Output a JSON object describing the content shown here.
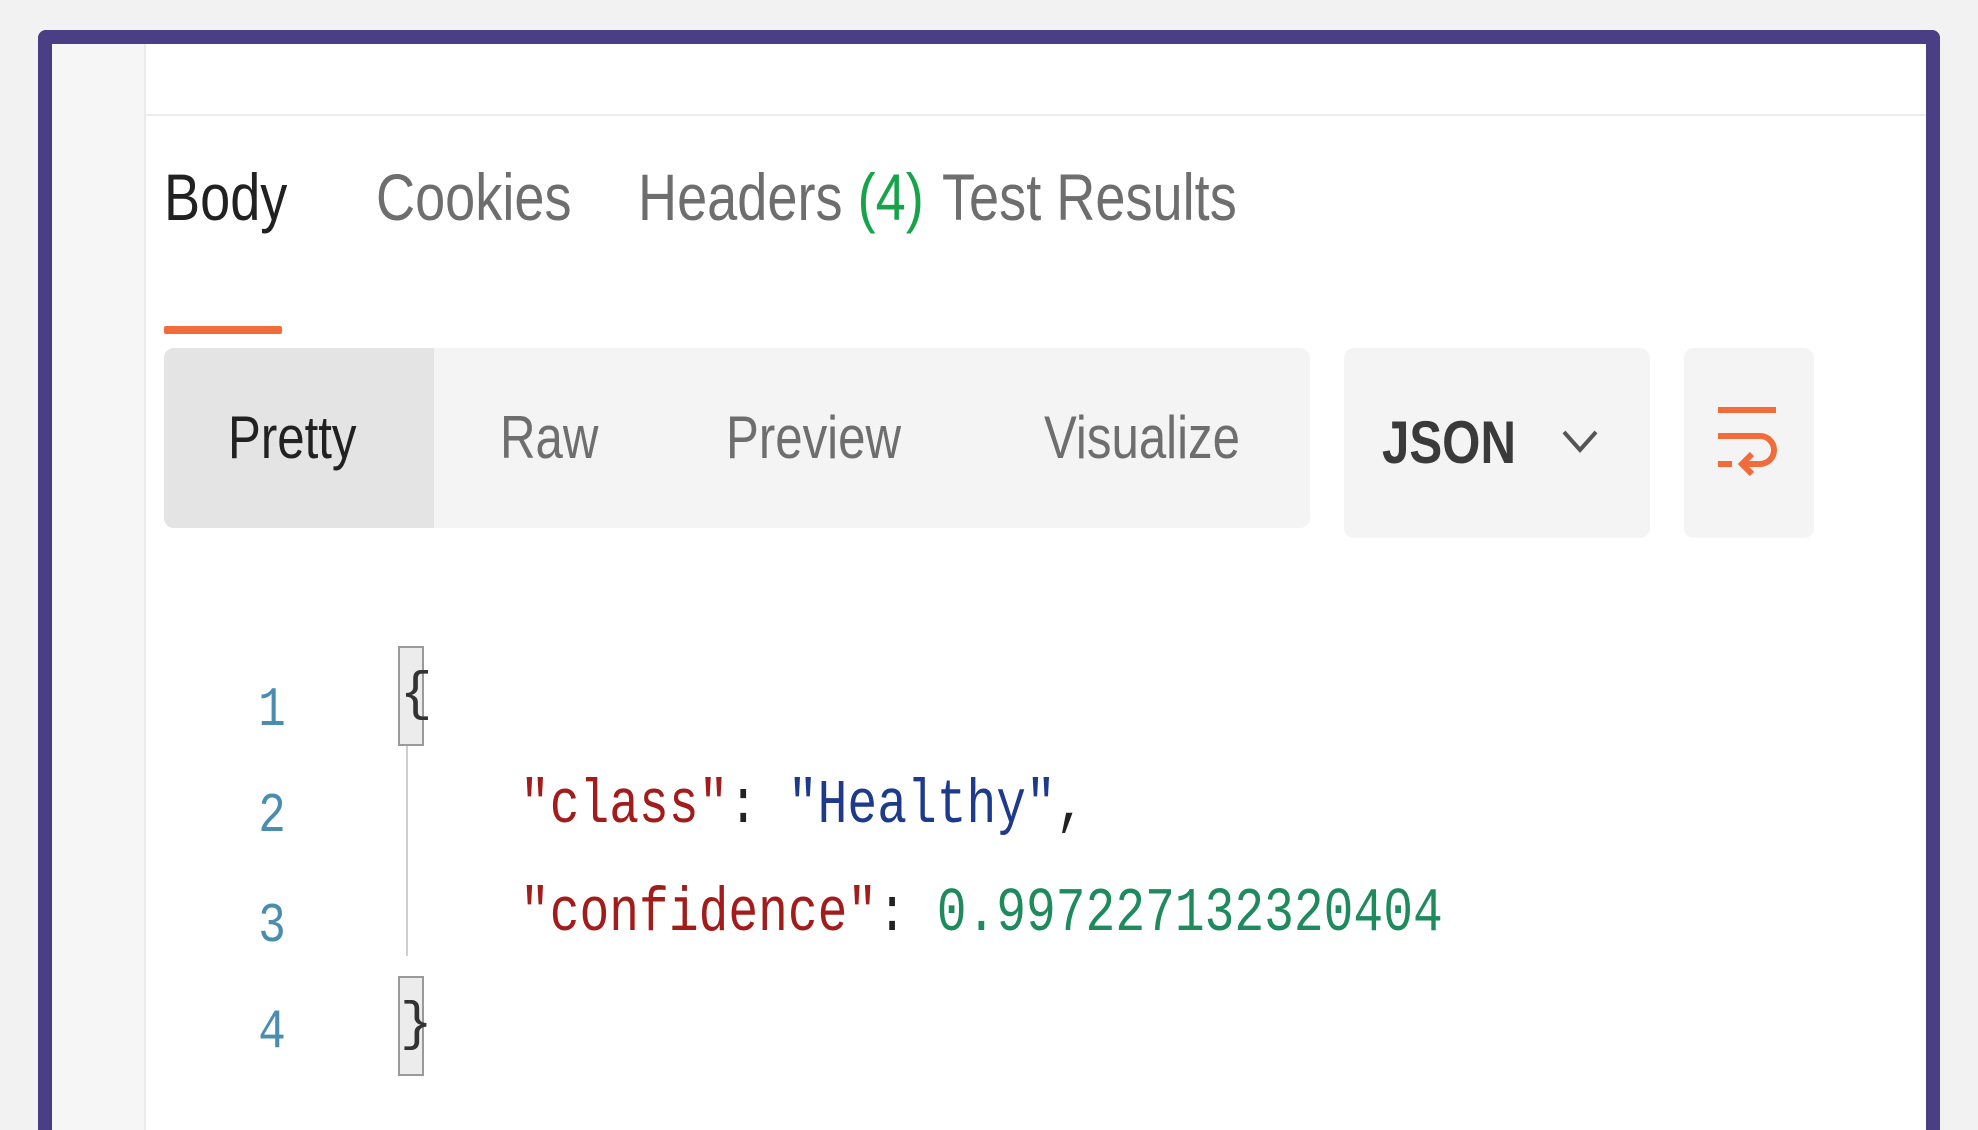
{
  "tabs": [
    {
      "label": "Body",
      "active": true
    },
    {
      "label": "Cookies",
      "active": false
    },
    {
      "label": "Headers",
      "count": "(4)",
      "active": false
    },
    {
      "label": "Test Results",
      "active": false
    }
  ],
  "view_modes": [
    {
      "label": "Pretty",
      "active": true
    },
    {
      "label": "Raw",
      "active": false
    },
    {
      "label": "Preview",
      "active": false
    },
    {
      "label": "Visualize",
      "active": false
    }
  ],
  "format_select": {
    "value": "JSON",
    "icon": "chevron-down-icon"
  },
  "wrap_button": {
    "icon": "wrap-lines-icon"
  },
  "code": {
    "line_numbers": [
      "1",
      "2",
      "3",
      "4"
    ],
    "open_brace": "{",
    "close_brace": "}",
    "line2": {
      "key": "\"class\"",
      "colon": ": ",
      "value": "\"Healthy\"",
      "comma": ","
    },
    "line3": {
      "key": "\"confidence\"",
      "colon": ": ",
      "value": "0.997227132320404"
    }
  },
  "colors": {
    "frame": "#4a3f84",
    "tab_underline": "#f26b3a",
    "count": "#17a34a",
    "json_key": "#a21c1c",
    "json_string": "#1e3a8a",
    "json_number": "#1f8a5e",
    "line_number": "#4a8db1"
  }
}
